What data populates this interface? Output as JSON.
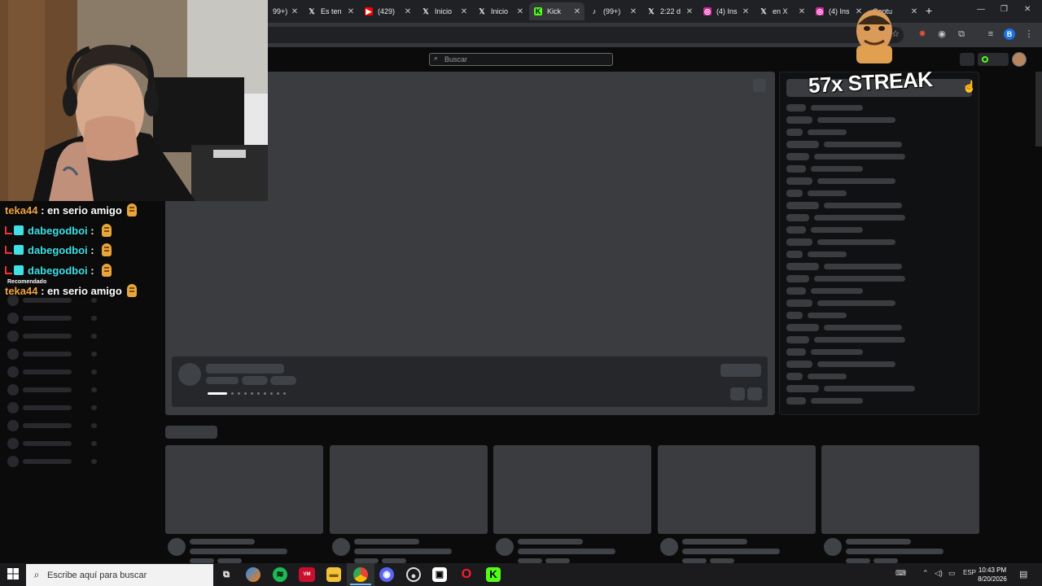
{
  "browser": {
    "tabs": [
      {
        "title": "99+) ",
        "icon": "generic-tab-icon",
        "color": "#202124"
      },
      {
        "title": "Es ten",
        "icon": "x-logo-icon"
      },
      {
        "title": "(429)",
        "icon": "youtube-icon"
      },
      {
        "title": "Inicio",
        "icon": "x-logo-icon"
      },
      {
        "title": "Inicio",
        "icon": "x-logo-icon"
      },
      {
        "title": "Kick",
        "icon": "kick-icon",
        "active": true
      },
      {
        "title": "(99+)",
        "icon": "tiktok-icon"
      },
      {
        "title": "2:22 d",
        "icon": "x-logo-icon"
      },
      {
        "title": "(4) Ins",
        "icon": "instagram-icon"
      },
      {
        "title": "en X",
        "icon": "x-logo-icon"
      },
      {
        "title": "(4) Ins",
        "icon": "instagram-icon"
      },
      {
        "title": "Captu",
        "icon": "generic-tab-icon"
      }
    ],
    "new_tab": "+",
    "close_glyph": "✕",
    "profile_letter": "B"
  },
  "kick": {
    "search_placeholder": "Buscar",
    "sidebar_heading": "Recomendado"
  },
  "overlay": {
    "streak_text": "57x STREAK",
    "chat": [
      {
        "user": "teka44",
        "sep": " : ",
        "message": "en serio amigo",
        "color": "orange",
        "badges": false
      },
      {
        "user": "dabegodboi",
        "sep": " : ",
        "message": "",
        "color": "cyan",
        "badges": true
      },
      {
        "user": "dabegodboi",
        "sep": " : ",
        "message": "",
        "color": "cyan",
        "badges": true
      },
      {
        "user": "dabegodboi",
        "sep": " : ",
        "message": "",
        "color": "cyan",
        "badges": true
      },
      {
        "user": "teka44",
        "sep": " : ",
        "message": "en serio amigo",
        "color": "orange",
        "badges": false
      }
    ]
  },
  "taskbar": {
    "search_placeholder": "Escribe aquí para buscar",
    "language": "ESP",
    "time": "10:43 PM",
    "date": "8/20/2026"
  }
}
